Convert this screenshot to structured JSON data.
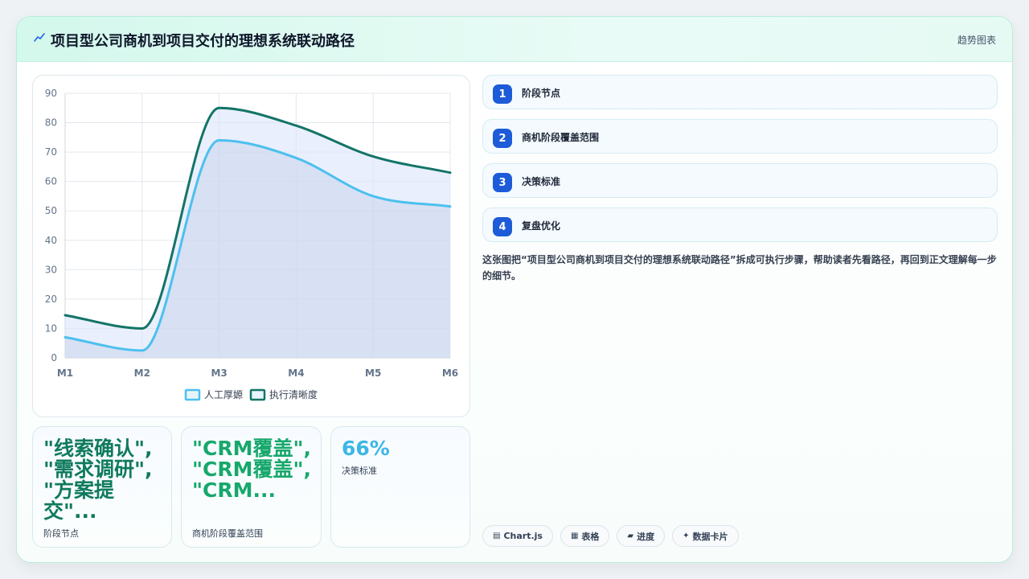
{
  "header": {
    "title": "项目型公司商机到项目交付的理想系统联动路径",
    "tag": "趋势图表"
  },
  "chart_data": {
    "type": "line",
    "categories": [
      "M1",
      "M2",
      "M3",
      "M4",
      "M5",
      "M6"
    ],
    "ylim": [
      0,
      90
    ],
    "yticks": [
      0,
      10,
      20,
      30,
      40,
      50,
      60,
      70,
      80,
      90
    ],
    "grid": true,
    "legend_position": "bottom",
    "series": [
      {
        "name": "人工厚嫄",
        "values": [
          7,
          2.5,
          74,
          68,
          55,
          51.5
        ],
        "color": "#4cc0ee",
        "fill": "rgba(200,212,235,0.55)"
      },
      {
        "name": "执行清晰度",
        "values": [
          14.5,
          10,
          85,
          79,
          68.5,
          63
        ],
        "color": "#137467",
        "fill": "rgba(220,228,252,0.6)"
      }
    ]
  },
  "kpis": [
    {
      "value": "\"线索确认\", \"需求调研\", \"方案提交\"...",
      "label": "阶段节点",
      "color": "#0f7a5e"
    },
    {
      "value": "\"CRM覆盖\", \"CRM覆盖\", \"CRM...",
      "label": "商机阶段覆盖范围",
      "color": "#17a86c"
    },
    {
      "value": "66%",
      "label": "决策标准",
      "color": "#3cb6e6"
    }
  ],
  "steps": [
    {
      "num": "1",
      "label": "阶段节点"
    },
    {
      "num": "2",
      "label": "商机阶段覆盖范围"
    },
    {
      "num": "3",
      "label": "决策标准"
    },
    {
      "num": "4",
      "label": "复盘优化"
    }
  ],
  "description": "这张图把“项目型公司商机到项目交付的理想系统联动路径”拆成可执行步骤，帮助读者先看路径，再回到正文理解每一步的细节。",
  "chips": [
    {
      "icon": "▤",
      "icon_name": "chart-icon",
      "label": "Chart.js"
    },
    {
      "icon": "▦",
      "icon_name": "table-icon",
      "label": "表格"
    },
    {
      "icon": "▰",
      "icon_name": "progress-icon",
      "label": "进度"
    },
    {
      "icon": "✦",
      "icon_name": "sparkle-icon",
      "label": "数据卡片"
    }
  ]
}
